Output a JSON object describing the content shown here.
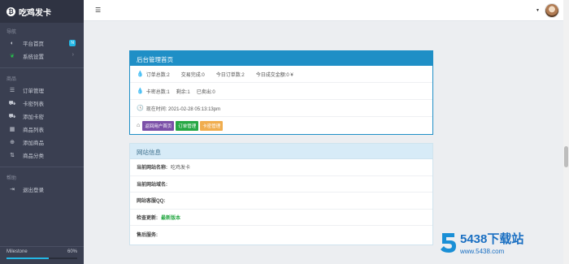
{
  "brand": {
    "name": "吃鸡发卡"
  },
  "sidebar": {
    "nav_title": "导航",
    "nav_items": [
      {
        "label": "平台首页",
        "icon": "dashboard-icon",
        "badge": "N"
      },
      {
        "label": "系统设置",
        "icon": "leaf-icon",
        "arrow": "›"
      }
    ],
    "goods_title": "商品",
    "goods_items": [
      {
        "label": "订单管理",
        "icon": "list-icon"
      },
      {
        "label": "卡密列表",
        "icon": "cart-icon"
      },
      {
        "label": "添加卡密",
        "icon": "cart-plus-icon"
      },
      {
        "label": "商品列表",
        "icon": "grid-icon"
      },
      {
        "label": "添加商品",
        "icon": "plus-circle-icon"
      },
      {
        "label": "商品分类",
        "icon": "sort-icon"
      }
    ],
    "help_title": "帮助",
    "help_items": [
      {
        "label": "退出登录",
        "icon": "logout-icon"
      }
    ],
    "milestone": {
      "label": "Milestone",
      "value": "60%",
      "progress": 0.6
    }
  },
  "admin_panel": {
    "title": "后台管理首页",
    "stats": {
      "orders_total": "订单总数:2",
      "deals_done": "交易完成:0",
      "today_orders": "今日订单数:2",
      "today_amount": "今日成交金额:0 ¥"
    },
    "cards": {
      "total": "卡密总数:1",
      "remaining": "剩余:1",
      "sold": "已卖出:0"
    },
    "time": "现在时间:  2021-02-28 05:13:13pm",
    "tags": [
      {
        "label": "返回用户首页",
        "color": "#7b4fa8"
      },
      {
        "label": "订单管理",
        "color": "#27a844"
      },
      {
        "label": "卡密管理",
        "color": "#f0ad4e"
      }
    ]
  },
  "site_panel": {
    "title": "网站信息",
    "rows": [
      {
        "label": "当前网站名称:",
        "value": "吃鸡发卡"
      },
      {
        "label": "当前网站域名:",
        "value": ""
      },
      {
        "label": "网站客服QQ:",
        "value": ""
      },
      {
        "label": "检查更新:",
        "value": "最新版本"
      },
      {
        "label": "售后服务:",
        "value": ""
      }
    ]
  },
  "watermark": {
    "main": "5438下载站",
    "url": "www.5438.com"
  },
  "colors": {
    "sidebar": "#3a3f51",
    "accent": "#1f8fc6",
    "info": "#23b7e5"
  }
}
